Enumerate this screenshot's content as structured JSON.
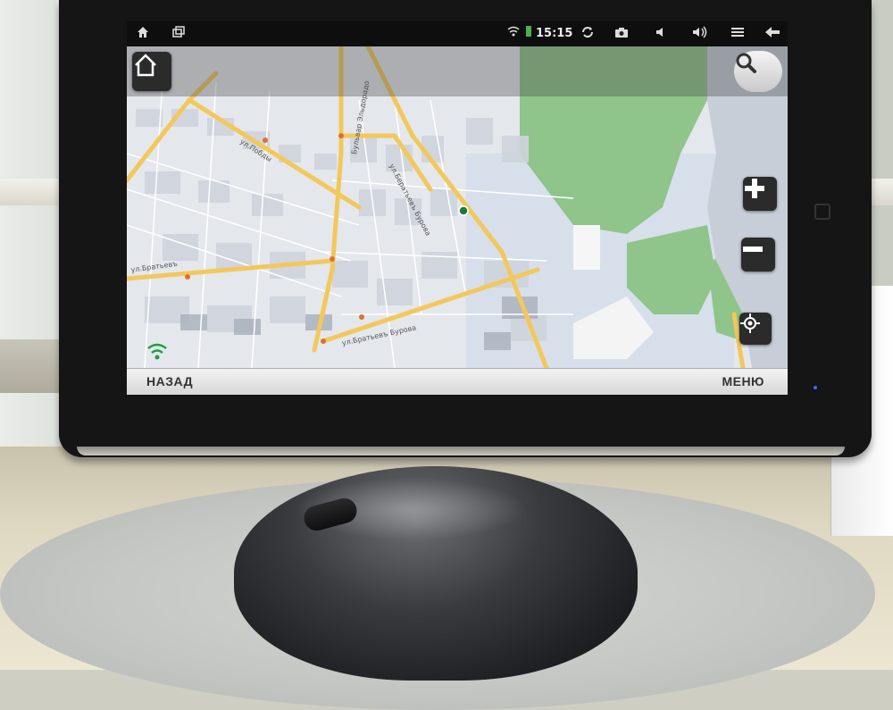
{
  "statusbar": {
    "time": "15:15",
    "icons": [
      "home-icon",
      "recent-apps-icon",
      "wifi-icon",
      "battery-icon",
      "sync-icon",
      "camera-icon",
      "volume-down-icon",
      "volume-up-icon",
      "menu-icon",
      "back-icon"
    ]
  },
  "map": {
    "streets": [
      "ул.Побды",
      "Бульвар Эльдорадо",
      "ул.Бератьевъ Бурова",
      "ул.Братьевъ",
      "ул.Братьевъ Бурова"
    ],
    "controls": [
      "home-icon",
      "search-icon",
      "zoom-in-icon",
      "zoom-out-icon",
      "locate-icon"
    ]
  },
  "bottombar": {
    "back_label": "НАЗАД",
    "menu_label": "МЕНЮ"
  },
  "colors": {
    "water": "#c7ced8",
    "park": "#8fc48a",
    "road_major": "#f2c85b",
    "road_minor": "#ffffff",
    "block": "#d3d7de"
  }
}
